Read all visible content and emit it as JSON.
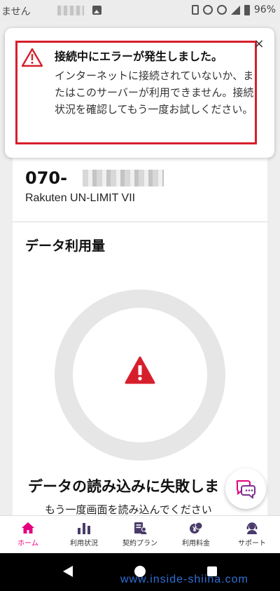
{
  "status_bar": {
    "left_text": "ません",
    "battery": "96%"
  },
  "notification": {
    "title": "接続中にエラーが発生しました。",
    "body": "インターネットに接続されていないか、またはこのサーバーが利用できません。接続状況を確認してもう一度お試しください。",
    "close_label": "×"
  },
  "line": {
    "number_prefix": "070-",
    "plan_name": "Rakuten UN-LIMIT VII"
  },
  "data_usage": {
    "title": "データ利用量",
    "error_heading": "データの読み込みに失敗しま",
    "error_sub": "もう一度画面を読み込んでください"
  },
  "bottom_nav": {
    "items": [
      {
        "label": "ホーム",
        "icon": "home-icon",
        "active": true
      },
      {
        "label": "利用状況",
        "icon": "bar-chart-icon",
        "active": false
      },
      {
        "label": "契約プラン",
        "icon": "contract-icon",
        "active": false
      },
      {
        "label": "利用料金",
        "icon": "yen-icon",
        "active": false
      },
      {
        "label": "サポート",
        "icon": "support-icon",
        "active": false
      }
    ]
  },
  "watermark": "www.inside-shiina.com",
  "colors": {
    "accent": "#e5007f",
    "warning_red": "#d71f2c",
    "highlight_border": "#d71f2c"
  }
}
